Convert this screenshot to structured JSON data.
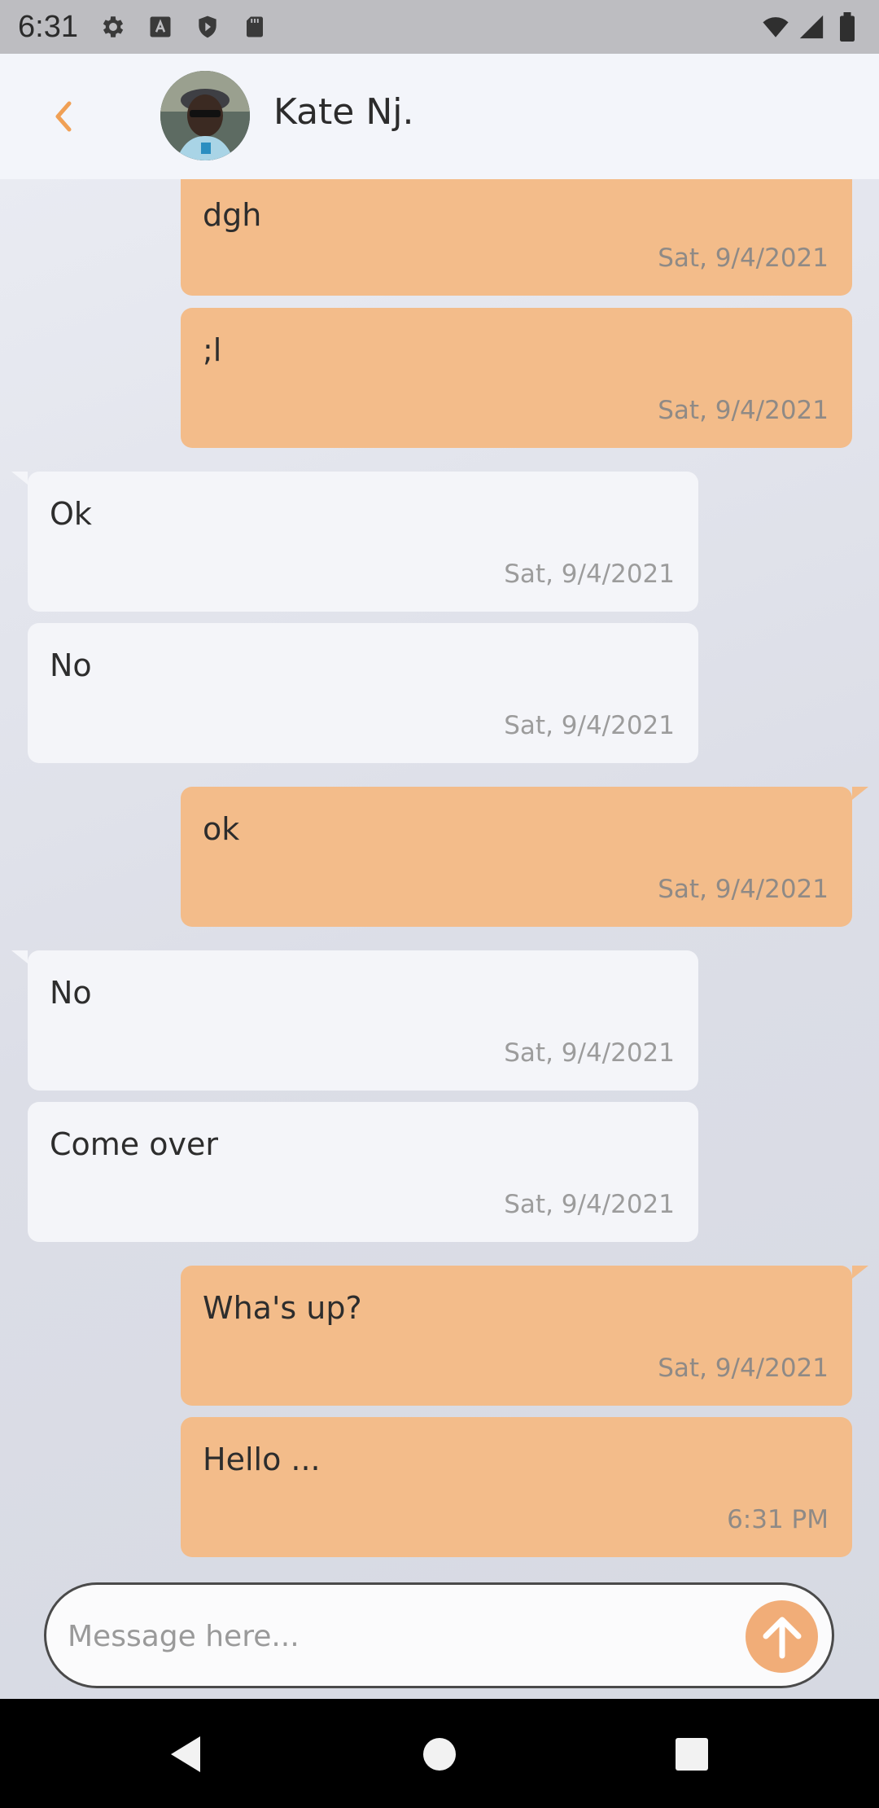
{
  "status_bar": {
    "time": "6:31",
    "left_icons": [
      "settings-gear-icon",
      "font-a-icon",
      "shield-play-icon",
      "sd-card-icon"
    ],
    "right_icons": [
      "wifi-icon",
      "cellular-signal-icon",
      "battery-icon"
    ]
  },
  "header": {
    "contact_name": "Kate Nj."
  },
  "messages": [
    {
      "direction": "out",
      "text": "dgh",
      "time": "Sat, 9/4/2021"
    },
    {
      "direction": "out",
      "text": ";l",
      "time": "Sat, 9/4/2021"
    },
    {
      "direction": "in",
      "text": "Ok",
      "time": "Sat, 9/4/2021"
    },
    {
      "direction": "in",
      "text": "No",
      "time": "Sat, 9/4/2021"
    },
    {
      "direction": "out",
      "text": "ok",
      "time": "Sat, 9/4/2021"
    },
    {
      "direction": "in",
      "text": "No",
      "time": "Sat, 9/4/2021"
    },
    {
      "direction": "in",
      "text": "Come over",
      "time": "Sat, 9/4/2021"
    },
    {
      "direction": "out",
      "text": "Wha's up?",
      "time": "Sat, 9/4/2021"
    },
    {
      "direction": "out",
      "text": "Hello ...",
      "time": "6:31 PM"
    }
  ],
  "composer": {
    "placeholder": "Message here..."
  },
  "colors": {
    "accent": "#f1ad78",
    "outgoing_bubble": "#f3bc8a",
    "incoming_bubble": "#f4f5f9",
    "back_arrow": "#f0a055"
  }
}
